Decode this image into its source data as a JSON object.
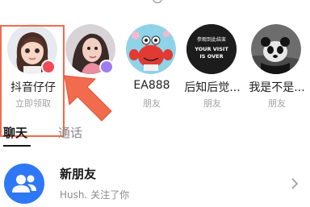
{
  "stories": [
    {
      "name": "抖音仔仔",
      "sub": "立即领取",
      "status_color": "#f24a57",
      "avatar": "girl-3d-avatar"
    },
    {
      "name": "",
      "sub": "",
      "status_color": "#a07cf0",
      "avatar": "photo-avatar-woman"
    },
    {
      "name": "EA888",
      "sub": "朋友",
      "status_color": "",
      "avatar": "cartoon-crab-avatar"
    },
    {
      "name": "后知后觉...",
      "sub": "朋友",
      "status_color": "",
      "avatar": "your-visit-is-over-avatar"
    },
    {
      "name": "我是不是...",
      "sub": "朋友",
      "status_color": "",
      "avatar": "panda-avatar"
    }
  ],
  "avatar_text": {
    "visit_line1": "参观到此结束",
    "visit_line2": "YOUR VISIT",
    "visit_line3": "IS OVER"
  },
  "tabs": [
    {
      "label": "聊天",
      "active": true
    },
    {
      "label": "通话",
      "active": false
    }
  ],
  "list": {
    "title": "新朋友",
    "subtitle": "Hush. 关注了你",
    "icon": "users-icon"
  },
  "colors": {
    "highlight": "#f26b4c",
    "accent_blue": "#2e77f6"
  }
}
